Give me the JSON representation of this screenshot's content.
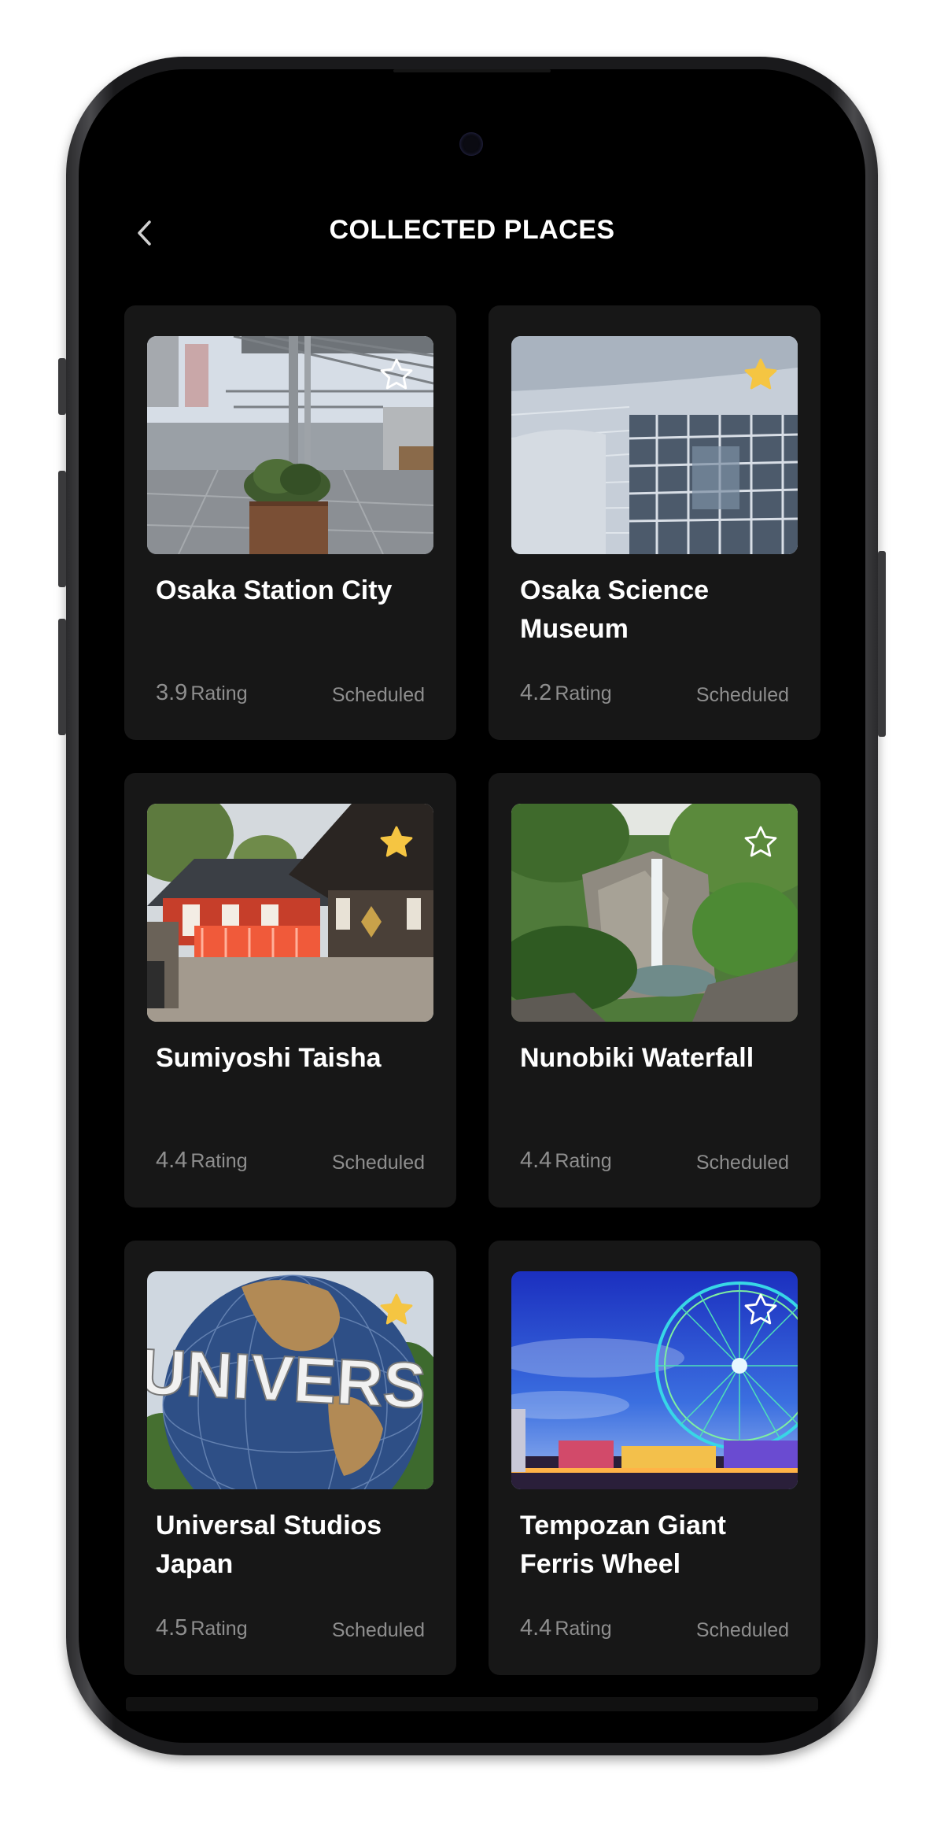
{
  "header": {
    "title": "COLLECTED PLACES",
    "back_icon": "chevron-left-icon"
  },
  "colors": {
    "background": "#000000",
    "card": "#171717",
    "star_active": "#F5C542",
    "text_muted": "#8e8e8e"
  },
  "places": [
    {
      "title": "Osaka Station City",
      "rating": "3.9",
      "rating_label": "Rating",
      "status": "Scheduled",
      "favorited": false
    },
    {
      "title": "Osaka Science Museum",
      "rating": "4.2",
      "rating_label": "Rating",
      "status": "Scheduled",
      "favorited": true
    },
    {
      "title": "Sumiyoshi Taisha",
      "rating": "4.4",
      "rating_label": "Rating",
      "status": "Scheduled",
      "favorited": true
    },
    {
      "title": "Nunobiki Waterfall",
      "rating": "4.4",
      "rating_label": "Rating",
      "status": "Scheduled",
      "favorited": false
    },
    {
      "title": "Universal Studios Japan",
      "rating": "4.5",
      "rating_label": "Rating",
      "status": "Scheduled",
      "favorited": true
    },
    {
      "title": "Tempozan Giant Ferris Wheel",
      "rating": "4.4",
      "rating_label": "Rating",
      "status": "Scheduled",
      "favorited": false
    }
  ]
}
